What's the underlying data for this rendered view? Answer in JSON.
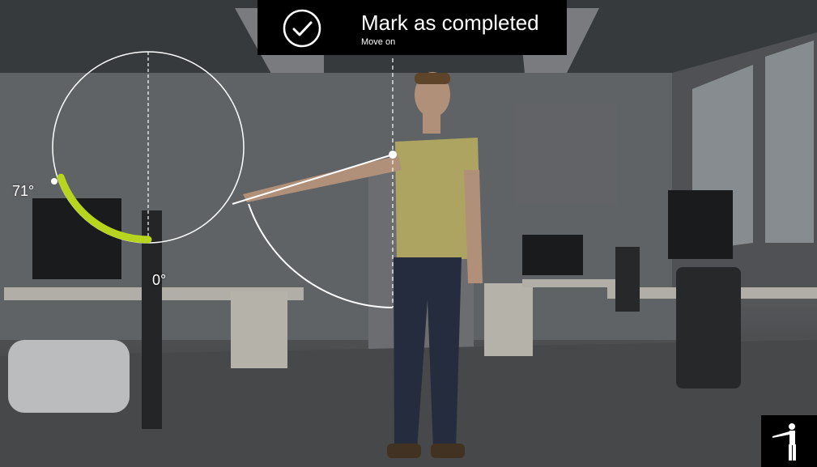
{
  "toast": {
    "title": "Mark as completed",
    "subtitle": "Move on",
    "icon": "check-circle-icon"
  },
  "gauge": {
    "current_angle_label": "71°",
    "start_angle_label": "0°",
    "current_angle_deg": 71,
    "accent_color": "#b7d41e"
  },
  "pose_button": {
    "icon": "arm-raise-pose-icon"
  }
}
